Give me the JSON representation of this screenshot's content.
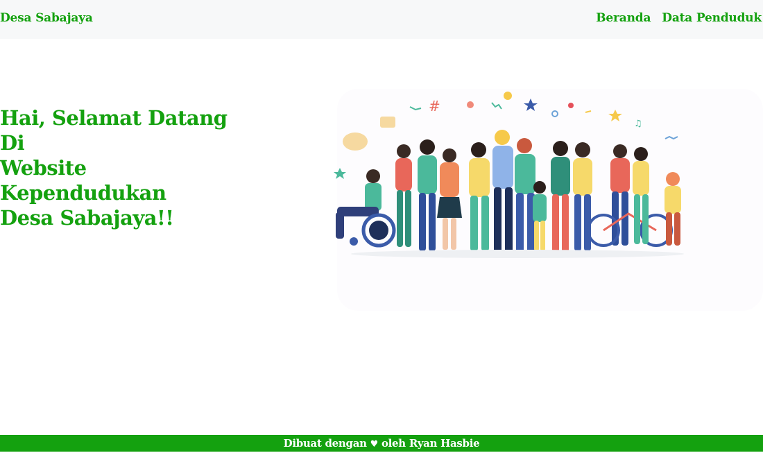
{
  "navbar": {
    "brand": "Desa Sabajaya",
    "links": [
      {
        "label": "Beranda"
      },
      {
        "label": "Data Penduduk"
      }
    ]
  },
  "hero": {
    "title_line1": "Hai, Selamat Datang Di",
    "title_line2": "Website Kependudukan",
    "title_line3": "Desa Sabajaya!!",
    "illustration": "crowd-of-diverse-people-illustration"
  },
  "footer": {
    "text_before": "Dibuat dengan ",
    "heart": "♥",
    "text_after": " oleh Ryan Hasbie"
  },
  "colors": {
    "accent": "#14a10f",
    "navbar_bg": "#f7f8f9",
    "footer_bg": "#14a10f"
  }
}
